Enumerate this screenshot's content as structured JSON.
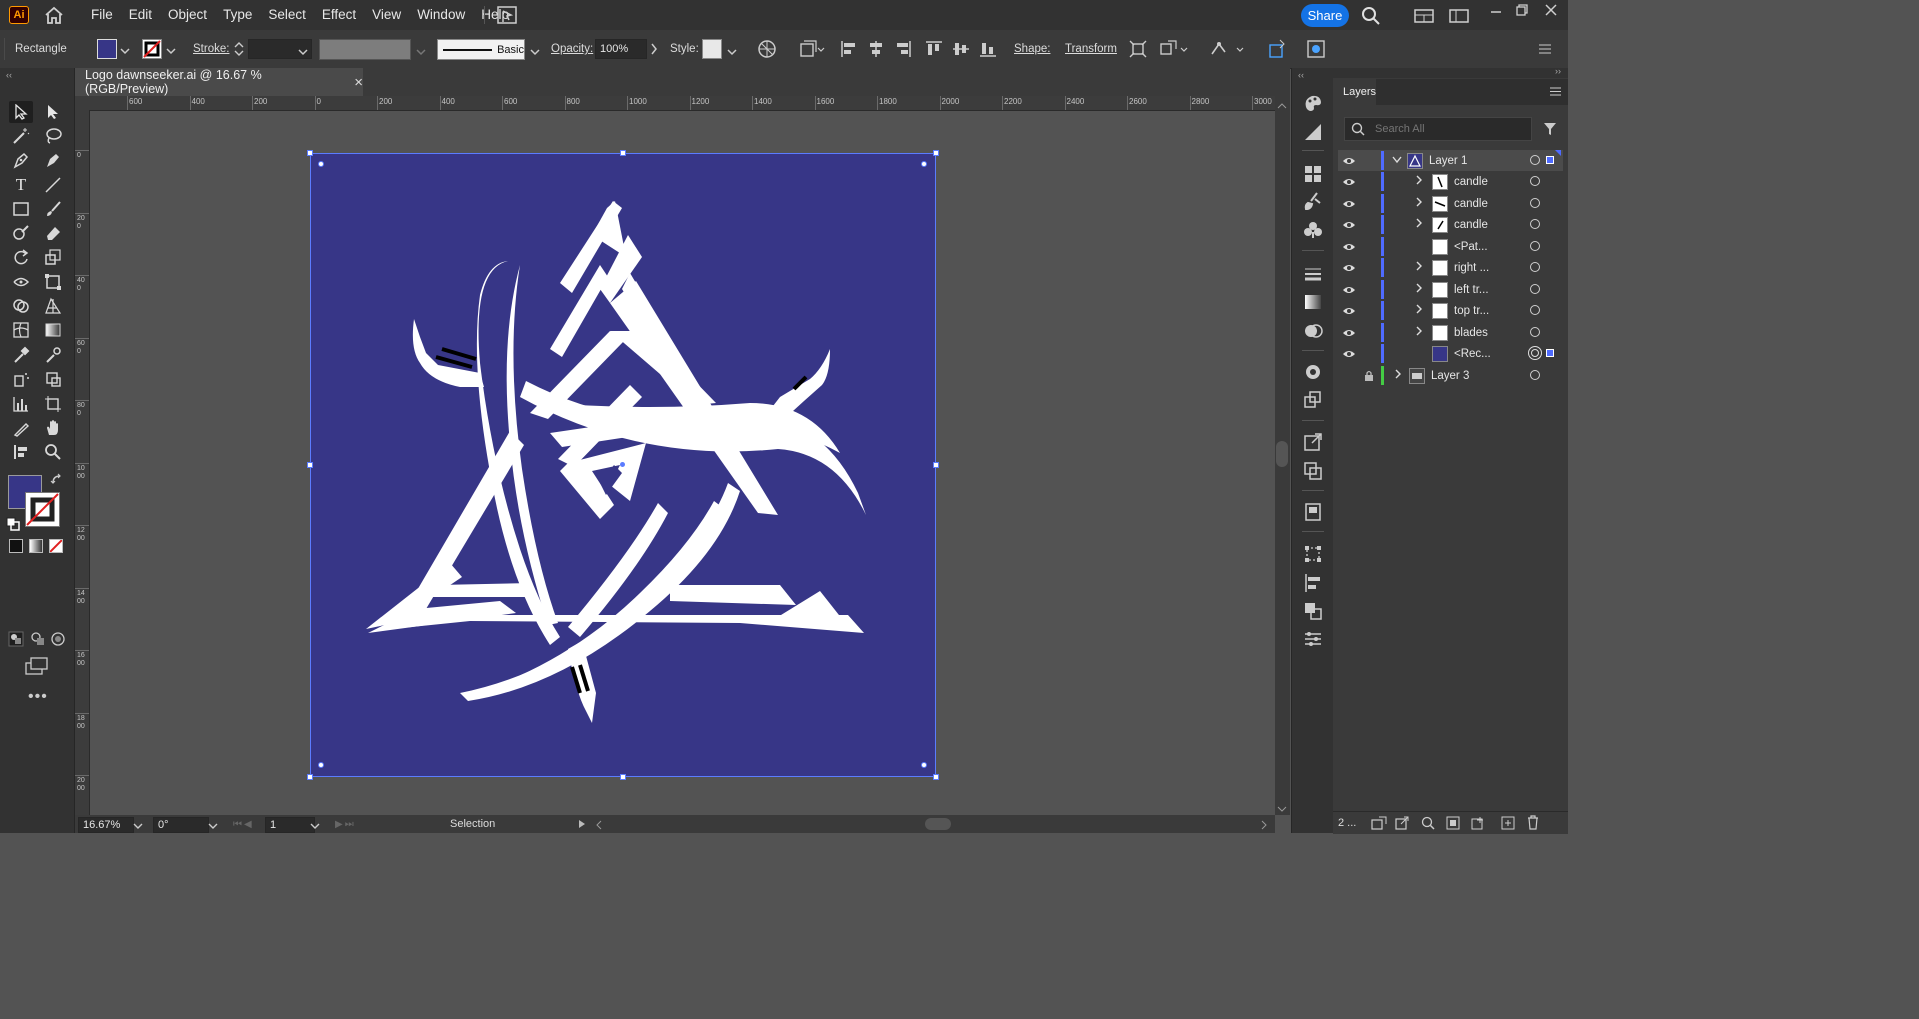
{
  "app": {
    "logo_text": "Ai"
  },
  "menu": {
    "items": [
      "File",
      "Edit",
      "Object",
      "Type",
      "Select",
      "Effect",
      "View",
      "Window",
      "Help"
    ]
  },
  "share_label": "Share",
  "control_bar": {
    "selection_label": "Rectangle",
    "fill_color": "#373687",
    "stroke_label": "Stroke:",
    "stroke_profile": "Basic",
    "opacity_label": "Opacity:",
    "opacity_value": "100%",
    "style_label": "Style:",
    "shape_label": "Shape:",
    "transform_label": "Transform"
  },
  "document": {
    "tab_title": "Logo dawnseeker.ai @ 16.67 % (RGB/Preview)",
    "close_glyph": "×",
    "artboard_color": "#373687"
  },
  "ruler": {
    "h_labels": [
      "600",
      "400",
      "200",
      "0",
      "200",
      "400",
      "600",
      "800",
      "1000",
      "1200",
      "1400",
      "1600",
      "1800",
      "2000",
      "2200",
      "2400",
      "2600",
      "2800",
      "3000"
    ],
    "v_labels": [
      "0",
      "200",
      "400",
      "600",
      "800",
      "1000",
      "1200",
      "1400",
      "1600",
      "1800",
      "2000"
    ]
  },
  "status": {
    "zoom": "16.67%",
    "rotation": "0°",
    "artboard_number": "1",
    "tool_name": "Selection"
  },
  "layers_panel": {
    "title": "Layers",
    "search_placeholder": "Search All",
    "footer_count": "2 ...",
    "rows": [
      {
        "name": "Layer 1",
        "expanded": true,
        "selected": true,
        "thumb": "layer1"
      },
      {
        "name": "candle",
        "expandable": true
      },
      {
        "name": "candle",
        "expandable": true
      },
      {
        "name": "candle",
        "expandable": true
      },
      {
        "name": "<Pat...",
        "expandable": false
      },
      {
        "name": "right ...",
        "expandable": true
      },
      {
        "name": "left tr...",
        "expandable": true
      },
      {
        "name": "top tr...",
        "expandable": true
      },
      {
        "name": "blades",
        "expandable": true
      },
      {
        "name": "<Rec...",
        "expandable": false,
        "thumb_color": "#373687"
      },
      {
        "name": "Layer 3",
        "expandable": true,
        "locked": true
      }
    ]
  },
  "colors": {
    "accent": "#1473e6",
    "layer1_color": "#4f6bff",
    "layer3_color": "#44cc44",
    "selection_blue": "#5b7cff"
  }
}
